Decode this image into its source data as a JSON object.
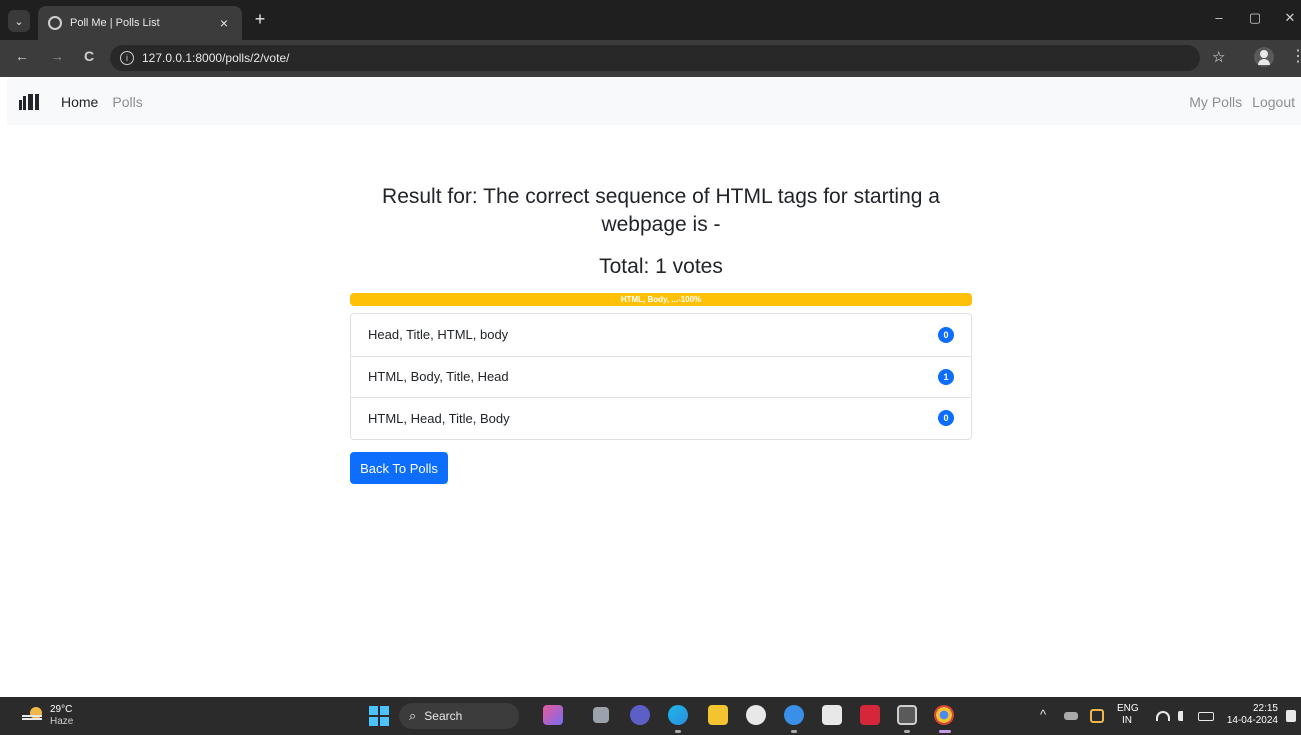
{
  "browser": {
    "tab_title": "Poll Me | Polls List",
    "tab_close": "×",
    "new_tab": "+",
    "url": "127.0.0.1:8000/polls/2/vote/",
    "controls": {
      "minimize": "–",
      "maximize": "▢",
      "close": "✕"
    },
    "nav": {
      "back": "←",
      "forward": "→",
      "reload": "C",
      "info": "i",
      "bookmark": "☆",
      "menu": "⋮"
    }
  },
  "navbar": {
    "home": "Home",
    "polls": "Polls",
    "my_polls": "My Polls",
    "logout": "Logout"
  },
  "result": {
    "title": "Result for: The correct sequence of HTML tags for starting a webpage is -",
    "total": "Total: 1 votes",
    "progress_label": "HTML, Body, ...-100%",
    "progress_percent": 100,
    "choices": [
      {
        "label": "Head, Title, HTML, body",
        "votes": "0"
      },
      {
        "label": "HTML, Body, Title, Head",
        "votes": "1"
      },
      {
        "label": "HTML, Head, Title, Body",
        "votes": "0"
      }
    ],
    "back_button": "Back To Polls"
  },
  "taskbar": {
    "temperature": "29°C",
    "condition": "Haze",
    "search": "Search",
    "search_glyph": "⌕",
    "tray_caret": "^",
    "lang_top": "ENG",
    "lang_bottom": "IN",
    "time": "22:15",
    "date": "14-04-2024"
  },
  "colors": {
    "primary": "#0d6efd",
    "progress": "#ffc107",
    "navbar_bg": "#f8f9fa",
    "chrome_bg": "#1f1f1f",
    "taskbar_bg": "#2b2b2b"
  }
}
